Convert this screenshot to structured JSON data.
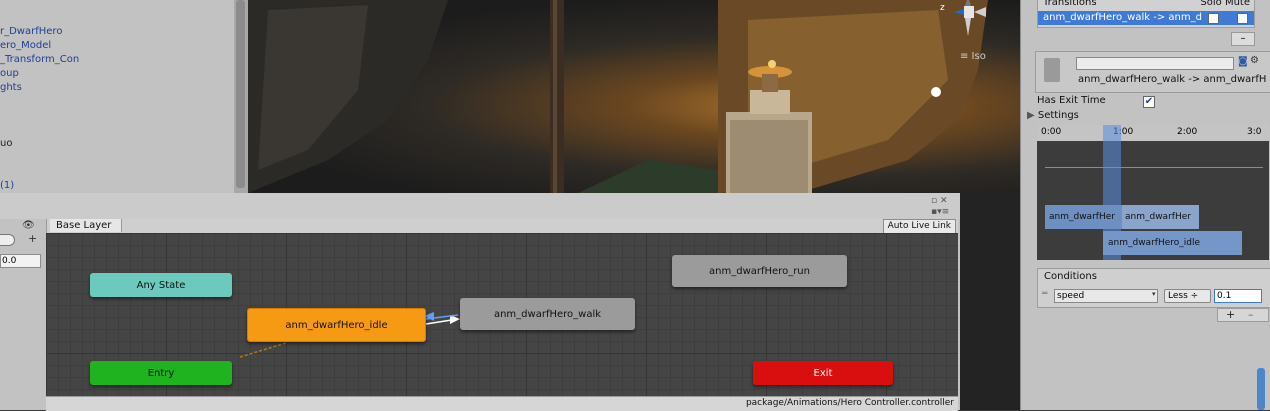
{
  "hierarchy": {
    "rows": [
      "r_DwarfHero",
      "ero_Model",
      "_Transform_Con",
      "oup",
      "ghts",
      "uo",
      "(1)"
    ]
  },
  "scene": {
    "iso_label": "≡ Iso",
    "gizmo_axis_label": "z"
  },
  "animator": {
    "layer_tab": "Base Layer",
    "auto_live_link": "Auto Live Link",
    "param_value": "0.0",
    "status_path": "package/Animations/Hero Controller.controller",
    "nodes": {
      "any_state": "Any State",
      "entry": "Entry",
      "idle": "anm_dwarfHero_idle",
      "walk": "anm_dwarfHero_walk",
      "run": "anm_dwarfHero_run",
      "exit": "Exit"
    },
    "colors": {
      "any_state": "#6cc9bd",
      "entry": "#1fb31f",
      "idle": "#f59a12",
      "state": "#9b9b9b",
      "exit": "#d90f0f"
    }
  },
  "inspector": {
    "transitions_header": "Transitions",
    "solo_mute": "Solo Mute",
    "transition_row": "anm_dwarfHero_walk -> anm_d",
    "minus": "–",
    "transition_title": "anm_dwarfHero_walk -> anm_dwarfH",
    "has_exit_time_label": "Has Exit Time",
    "has_exit_time": true,
    "settings_label": "Settings",
    "timeline": {
      "ticks": [
        "0:00",
        "1:00",
        "2:00",
        "3:0"
      ],
      "clip_a": "anm_dwarfHer",
      "clip_b": "anm_dwarfHer",
      "clip_c": "anm_dwarfHero_idle"
    },
    "conditions_header": "Conditions",
    "condition": {
      "param": "speed",
      "op": "Less",
      "value": "0.1"
    },
    "plus": "+",
    "minus2": "–"
  }
}
